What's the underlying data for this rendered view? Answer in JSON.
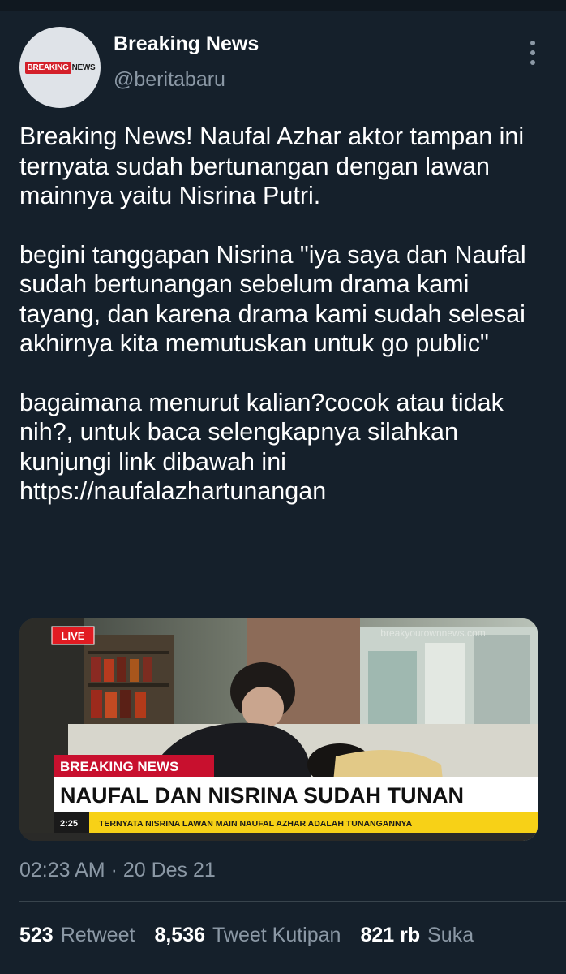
{
  "tweet": {
    "author": {
      "name": "Breaking News",
      "handle": "@beritabaru",
      "avatar_logo": {
        "red_part": "BREAKING",
        "dark_part": "NEWS"
      }
    },
    "paragraphs": [
      "Breaking News! Naufal Azhar aktor tampan ini ternyata sudah bertunangan dengan lawan mainnya yaitu Nisrina Putri.",
      "begini tanggapan Nisrina \"iya saya dan Naufal sudah bertunangan sebelum drama kami tayang, dan karena drama kami sudah selesai akhirnya kita memutuskan untuk go public\"",
      "bagaimana menurut kalian?cocok atau tidak nih?, untuk baca selengkapnya silahkan kunjungi link dibawah ini https://naufalazhartunangan"
    ],
    "media": {
      "live_badge": "LIVE",
      "watermark": "breakyourownnews.com",
      "breaking_tag": "BREAKING NEWS",
      "headline": "NAUFAL DAN NISRINA SUDAH TUNAN",
      "ticker_time": "2:25",
      "ticker_text": "TERNYATA NISRINA LAWAN MAIN NAUFAL AZHAR ADALAH TUNANGANNYA"
    },
    "timestamp": "02:23 AM · 20 Des 21",
    "stats": {
      "retweets": "523",
      "retweets_label": "Retweet",
      "quotes": "8,536",
      "quotes_label": "Tweet Kutipan",
      "likes": "821 rb",
      "likes_label": "Suka"
    }
  },
  "colors": {
    "background": "#15202b",
    "secondary_text": "#8b98a5",
    "divider": "#38444d",
    "breaking_red": "#c8102e",
    "ticker_yellow": "#f7d117"
  },
  "icons": {
    "more": "more-vertical-icon"
  }
}
